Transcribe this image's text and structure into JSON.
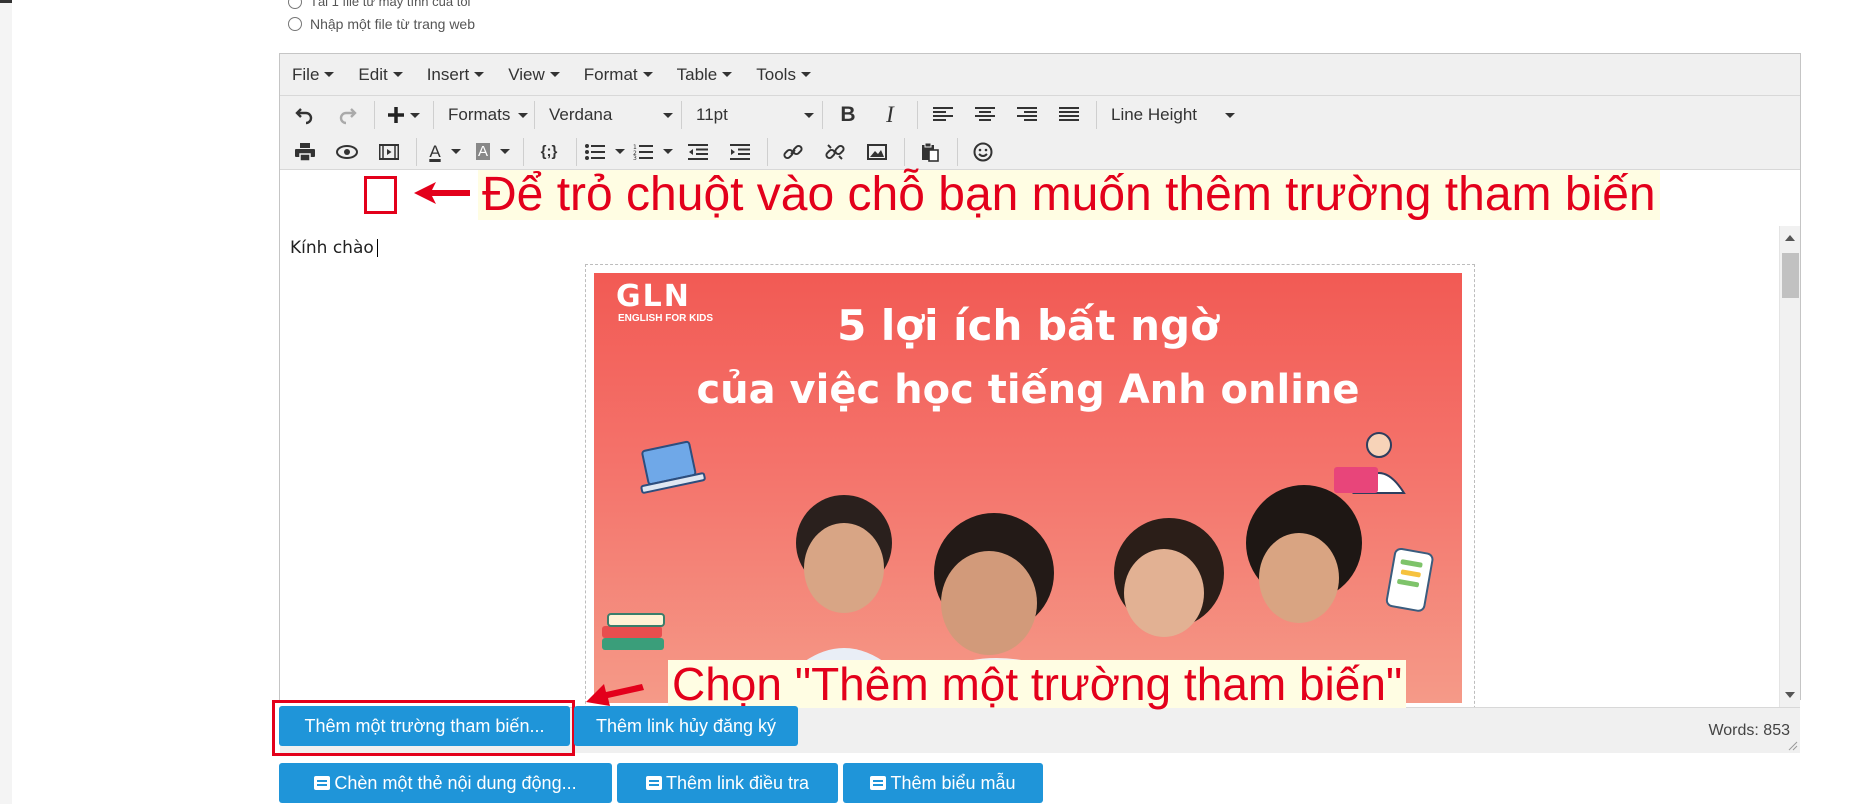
{
  "import_options": {
    "option_local": "Tải 1 file từ máy tính của tôi",
    "option_web": "Nhập một file từ trang web"
  },
  "editor": {
    "menus": [
      "File",
      "Edit",
      "Insert",
      "View",
      "Format",
      "Table",
      "Tools"
    ],
    "toolbar": {
      "formats_label": "Formats",
      "font_family": "Verdana",
      "font_size": "11pt",
      "line_height_label": "Line Height",
      "variable_btn": "{;}"
    },
    "content": {
      "greeting": "Kính chào",
      "banner": {
        "logo": "GLN",
        "logo_sub": "ENGLISH FOR KIDS",
        "title_line1": "5 lợi ích bất ngờ",
        "title_line2": "của việc học tiếng Anh online"
      }
    },
    "status": {
      "words": "Words: 853"
    }
  },
  "annotations": {
    "cursor_hint": "Để trỏ chuột vào chỗ bạn muốn thêm trường tham biến",
    "select_hint": "Chọn \"Thêm một trường tham biến\""
  },
  "actions": {
    "add_variable": "Thêm một trường tham biến...",
    "add_unsubscribe": "Thêm link hủy đăng ký",
    "insert_dynamic": "Chèn một thẻ nội dung động...",
    "add_survey": "Thêm link điều tra",
    "add_form": "Thêm biểu mẫu"
  },
  "colors": {
    "accent": "#1f95d9",
    "annotation_red": "#e3001b",
    "banner": "#f25a54"
  }
}
